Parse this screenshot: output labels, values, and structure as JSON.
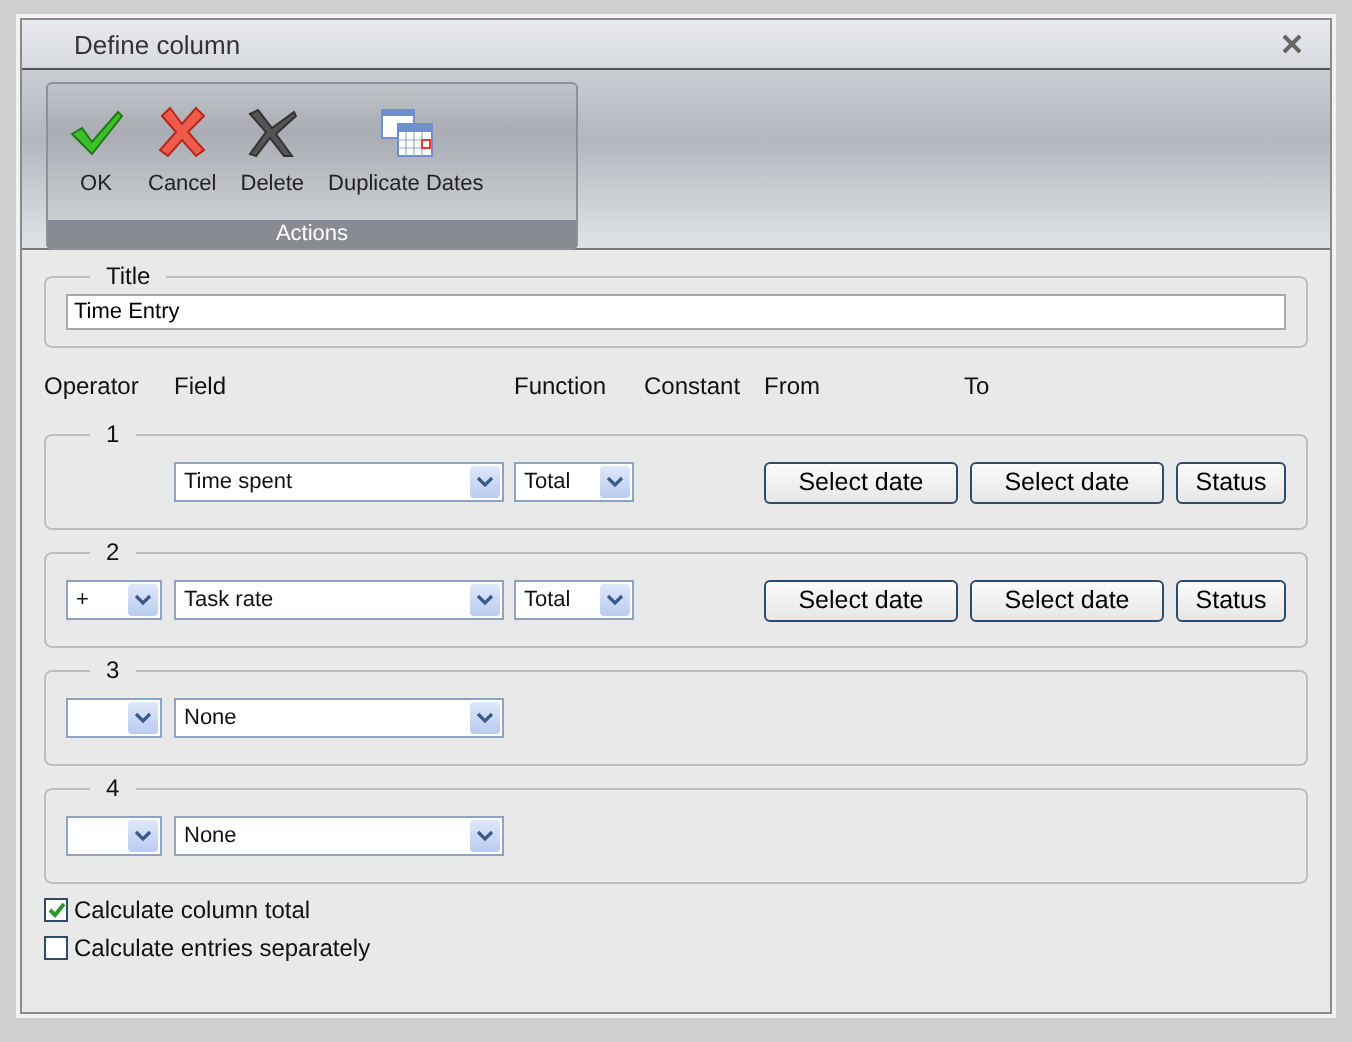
{
  "window": {
    "title": "Define column"
  },
  "ribbon": {
    "group": "Actions",
    "buttons": [
      {
        "label": "OK",
        "kind": "ok"
      },
      {
        "label": "Cancel",
        "kind": "cancel"
      },
      {
        "label": "Delete",
        "kind": "delete"
      },
      {
        "label": "Duplicate Dates",
        "kind": "dates"
      }
    ]
  },
  "title_field": {
    "legend": "Title",
    "value": "Time Entry"
  },
  "headers": [
    "Operator",
    "Field",
    "Function",
    "Constant",
    "From",
    "To"
  ],
  "rows": [
    {
      "legend": "1",
      "field": "Time spent",
      "function": "Total",
      "from": "Select date",
      "to": "Select date",
      "status": "Status"
    },
    {
      "legend": "2",
      "operator": "+",
      "field": "Task rate",
      "function": "Total",
      "from": "Select date",
      "to": "Select date",
      "status": "Status"
    },
    {
      "legend": "3",
      "operator": "",
      "field": "None"
    },
    {
      "legend": "4",
      "operator": "",
      "field": "None"
    }
  ],
  "checkboxes": [
    {
      "label": "Calculate column total",
      "checked": true
    },
    {
      "label": "Calculate entries separately",
      "checked": false
    }
  ]
}
